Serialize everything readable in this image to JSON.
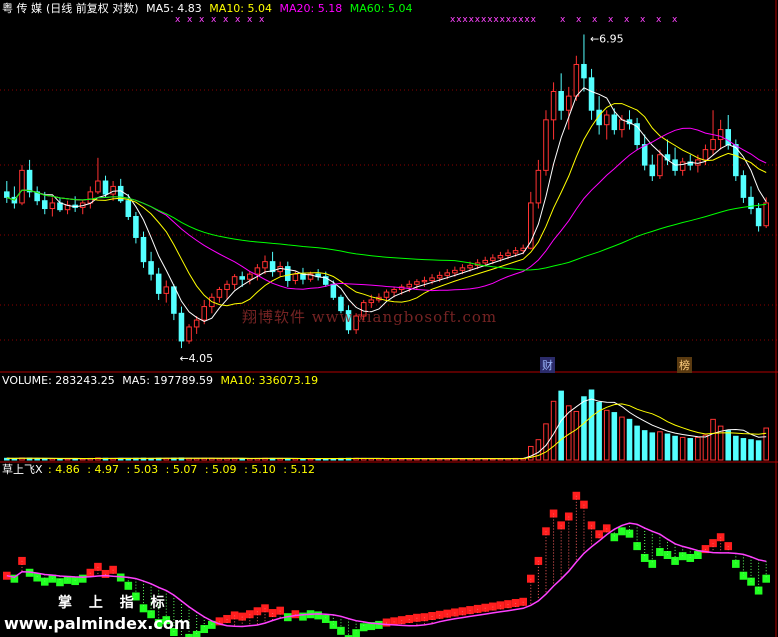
{
  "header": {
    "name": "粤 传 媒",
    "mode": "(日线 前复权 对数)",
    "ma5_label": "MA5: 4.83",
    "ma10_label": "MA10: 5.04",
    "ma20_label": "MA20: 5.18",
    "ma60_label": "MA60: 5.04"
  },
  "annotations": {
    "high_label": "6.95",
    "low_label": "4.05",
    "cai": "财",
    "bang": "榜"
  },
  "volume_header": {
    "volume_label": "VOLUME: 283243.25",
    "ma5_label": "MA5: 197789.59",
    "ma10_label": "MA10: 336073.19"
  },
  "indicator_header": {
    "name": "草上飞X",
    "values": [
      ": 4.86",
      ": 4.97",
      ": 5.03",
      ": 5.07",
      ": 5.09",
      ": 5.10",
      ": 5.12"
    ]
  },
  "watermarks": {
    "site": "翔博软件 www.xiangbosoft.com",
    "palm_cn": "掌 上 指 标",
    "palm_url": "www.palmindex.com"
  },
  "colors": {
    "up": "#ff3232",
    "down": "#54ffff",
    "ma5": "#ffffff",
    "ma10": "#ffff00",
    "ma20": "#ff00ff",
    "ma60": "#00ff00",
    "grid": "#8b0000"
  },
  "chart_data": {
    "type": "candlestick",
    "ylog": true,
    "ylim": [
      3.9,
      7.15
    ],
    "price_high": 6.95,
    "price_low": 4.05,
    "ohlc": [
      [
        5.3,
        5.4,
        5.2,
        5.25
      ],
      [
        5.25,
        5.35,
        5.15,
        5.2
      ],
      [
        5.2,
        5.55,
        5.18,
        5.5
      ],
      [
        5.5,
        5.6,
        5.25,
        5.3
      ],
      [
        5.3,
        5.35,
        5.18,
        5.22
      ],
      [
        5.22,
        5.3,
        5.1,
        5.15
      ],
      [
        5.15,
        5.25,
        5.08,
        5.2
      ],
      [
        5.2,
        5.25,
        5.12,
        5.14
      ],
      [
        5.14,
        5.22,
        5.1,
        5.18
      ],
      [
        5.18,
        5.26,
        5.12,
        5.16
      ],
      [
        5.16,
        5.22,
        5.1,
        5.2
      ],
      [
        5.2,
        5.35,
        5.15,
        5.3
      ],
      [
        5.3,
        5.62,
        5.28,
        5.4
      ],
      [
        5.4,
        5.45,
        5.25,
        5.28
      ],
      [
        5.28,
        5.4,
        5.22,
        5.35
      ],
      [
        5.35,
        5.42,
        5.2,
        5.22
      ],
      [
        5.22,
        5.28,
        5.05,
        5.08
      ],
      [
        5.08,
        5.12,
        4.85,
        4.9
      ],
      [
        4.9,
        4.95,
        4.65,
        4.7
      ],
      [
        4.7,
        4.78,
        4.55,
        4.6
      ],
      [
        4.6,
        4.65,
        4.4,
        4.45
      ],
      [
        4.45,
        4.55,
        4.38,
        4.5
      ],
      [
        4.5,
        4.52,
        4.25,
        4.3
      ],
      [
        4.3,
        4.35,
        4.05,
        4.1
      ],
      [
        4.1,
        4.22,
        4.08,
        4.2
      ],
      [
        4.2,
        4.28,
        4.15,
        4.25
      ],
      [
        4.25,
        4.4,
        4.22,
        4.35
      ],
      [
        4.35,
        4.45,
        4.3,
        4.42
      ],
      [
        4.42,
        4.5,
        4.38,
        4.48
      ],
      [
        4.48,
        4.55,
        4.4,
        4.52
      ],
      [
        4.52,
        4.6,
        4.48,
        4.58
      ],
      [
        4.58,
        4.62,
        4.5,
        4.56
      ],
      [
        4.56,
        4.62,
        4.52,
        4.6
      ],
      [
        4.6,
        4.68,
        4.55,
        4.65
      ],
      [
        4.65,
        4.75,
        4.6,
        4.7
      ],
      [
        4.7,
        4.78,
        4.58,
        4.62
      ],
      [
        4.62,
        4.7,
        4.58,
        4.66
      ],
      [
        4.66,
        4.7,
        4.5,
        4.55
      ],
      [
        4.55,
        4.62,
        4.52,
        4.6
      ],
      [
        4.6,
        4.65,
        4.52,
        4.56
      ],
      [
        4.56,
        4.62,
        4.54,
        4.6
      ],
      [
        4.6,
        4.64,
        4.55,
        4.58
      ],
      [
        4.58,
        4.62,
        4.5,
        4.52
      ],
      [
        4.52,
        4.55,
        4.4,
        4.42
      ],
      [
        4.42,
        4.44,
        4.3,
        4.32
      ],
      [
        4.32,
        4.36,
        4.15,
        4.18
      ],
      [
        4.18,
        4.3,
        4.15,
        4.28
      ],
      [
        4.28,
        4.4,
        4.25,
        4.38
      ],
      [
        4.38,
        4.44,
        4.34,
        4.4
      ],
      [
        4.4,
        4.45,
        4.38,
        4.42
      ],
      [
        4.42,
        4.48,
        4.4,
        4.46
      ],
      [
        4.46,
        4.5,
        4.42,
        4.48
      ],
      [
        4.48,
        4.52,
        4.44,
        4.5
      ],
      [
        4.5,
        4.55,
        4.46,
        4.52
      ],
      [
        4.52,
        4.56,
        4.48,
        4.54
      ],
      [
        4.54,
        4.58,
        4.5,
        4.55
      ],
      [
        4.55,
        4.6,
        4.52,
        4.57
      ],
      [
        4.57,
        4.62,
        4.54,
        4.59
      ],
      [
        4.59,
        4.64,
        4.56,
        4.61
      ],
      [
        4.61,
        4.66,
        4.58,
        4.63
      ],
      [
        4.63,
        4.68,
        4.6,
        4.65
      ],
      [
        4.65,
        4.7,
        4.62,
        4.67
      ],
      [
        4.67,
        4.72,
        4.64,
        4.69
      ],
      [
        4.69,
        4.74,
        4.66,
        4.71
      ],
      [
        4.71,
        4.76,
        4.68,
        4.73
      ],
      [
        4.73,
        4.78,
        4.7,
        4.75
      ],
      [
        4.75,
        4.8,
        4.72,
        4.77
      ],
      [
        4.77,
        4.82,
        4.74,
        4.79
      ],
      [
        4.79,
        4.84,
        4.76,
        4.81
      ],
      [
        4.81,
        5.3,
        4.8,
        5.2
      ],
      [
        5.2,
        5.6,
        5.15,
        5.5
      ],
      [
        5.5,
        6.1,
        5.45,
        6.0
      ],
      [
        6.0,
        6.4,
        5.8,
        6.3
      ],
      [
        6.3,
        6.5,
        6.0,
        6.1
      ],
      [
        6.1,
        6.35,
        5.9,
        6.25
      ],
      [
        6.25,
        6.7,
        6.2,
        6.6
      ],
      [
        6.6,
        6.95,
        6.3,
        6.45
      ],
      [
        6.45,
        6.55,
        6.0,
        6.1
      ],
      [
        6.1,
        6.25,
        5.85,
        5.95
      ],
      [
        5.95,
        6.1,
        5.8,
        6.05
      ],
      [
        6.05,
        6.12,
        5.85,
        5.9
      ],
      [
        5.9,
        6.05,
        5.82,
        6.0
      ],
      [
        6.0,
        6.1,
        5.9,
        5.96
      ],
      [
        5.96,
        6.02,
        5.7,
        5.75
      ],
      [
        5.75,
        5.85,
        5.5,
        5.55
      ],
      [
        5.55,
        5.65,
        5.4,
        5.45
      ],
      [
        5.45,
        5.7,
        5.42,
        5.65
      ],
      [
        5.65,
        5.8,
        5.55,
        5.6
      ],
      [
        5.6,
        5.72,
        5.45,
        5.5
      ],
      [
        5.5,
        5.62,
        5.45,
        5.58
      ],
      [
        5.58,
        5.65,
        5.5,
        5.55
      ],
      [
        5.55,
        5.65,
        5.48,
        5.6
      ],
      [
        5.6,
        5.75,
        5.55,
        5.7
      ],
      [
        5.7,
        6.1,
        5.65,
        5.8
      ],
      [
        5.8,
        6.0,
        5.7,
        5.9
      ],
      [
        5.9,
        6.05,
        5.7,
        5.75
      ],
      [
        5.75,
        5.8,
        5.4,
        5.45
      ],
      [
        5.45,
        5.5,
        5.2,
        5.25
      ],
      [
        5.25,
        5.35,
        5.1,
        5.15
      ],
      [
        5.15,
        5.2,
        4.95,
        5.0
      ],
      [
        5.0,
        5.25,
        4.98,
        5.2
      ]
    ],
    "volume": [
      15,
      14,
      18,
      16,
      13,
      12,
      13,
      12,
      12,
      13,
      12,
      14,
      18,
      15,
      14,
      14,
      13,
      15,
      16,
      14,
      15,
      14,
      16,
      18,
      15,
      14,
      15,
      15,
      14,
      14,
      14,
      13,
      13,
      14,
      15,
      14,
      14,
      13,
      13,
      12,
      12,
      12,
      12,
      13,
      14,
      15,
      15,
      14,
      13,
      12,
      12,
      12,
      12,
      12,
      12,
      12,
      12,
      12,
      12,
      12,
      12,
      12,
      12,
      12,
      12,
      13,
      13,
      14,
      14,
      120,
      180,
      320,
      520,
      610,
      480,
      430,
      560,
      620,
      510,
      440,
      420,
      380,
      360,
      300,
      260,
      240,
      250,
      230,
      210,
      200,
      190,
      200,
      220,
      360,
      300,
      260,
      210,
      190,
      180,
      170,
      283
    ],
    "indicator_ylim": [
      4.3,
      6.9
    ]
  }
}
